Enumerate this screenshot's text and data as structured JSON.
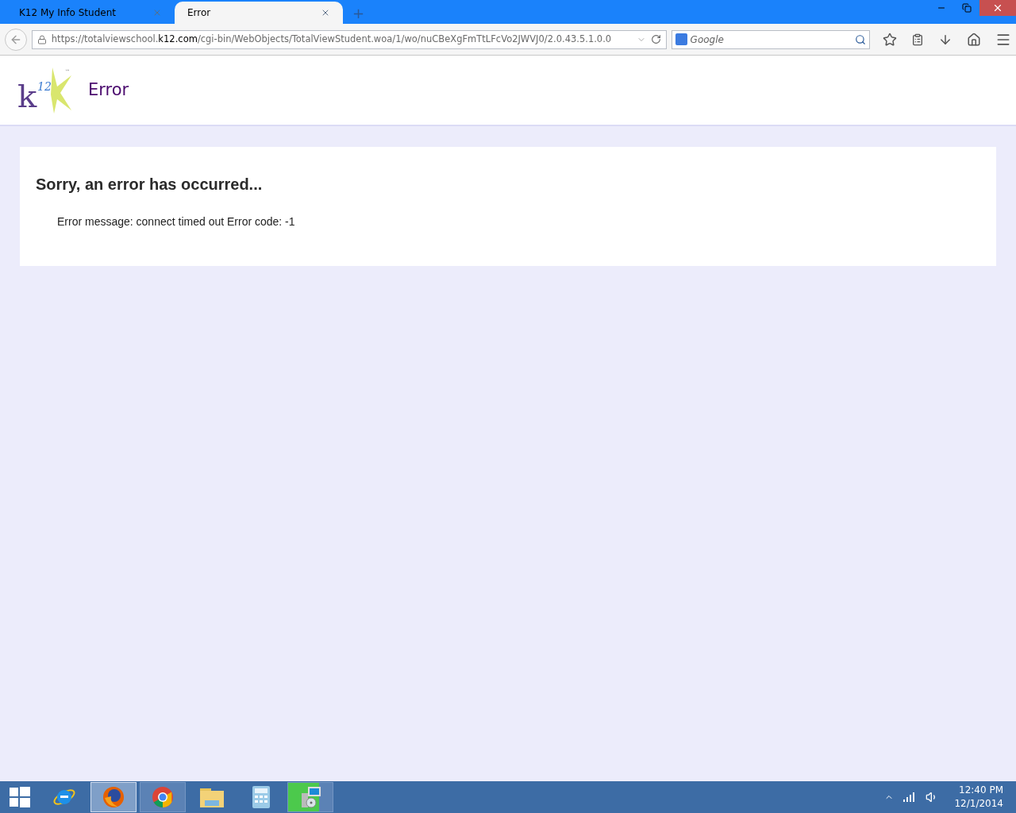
{
  "browser": {
    "tabs": [
      {
        "title": "K12 My Info Student",
        "selected": false
      },
      {
        "title": "Error",
        "selected": true
      }
    ],
    "new_tab": "+",
    "address": {
      "prefix": "https://totalviewschool.",
      "domain": "k12.com",
      "path": "/cgi-bin/WebObjects/TotalViewStudent.woa/1/wo/nuCBeXgFmTtLFcVo2JWVJ0/2.0.43.5.1.0.0"
    },
    "search": {
      "placeholder": "Google"
    }
  },
  "page": {
    "logo": {
      "letter": "k",
      "superscript": "12",
      "tm": "™"
    },
    "title": "Error",
    "heading": "Sorry, an error has occurred...",
    "message": "Error message: connect timed out Error code: -1"
  },
  "taskbar": {
    "apps": [
      {
        "kind": "ie",
        "selected": false,
        "running": false
      },
      {
        "kind": "firefox",
        "selected": true,
        "running": true
      },
      {
        "kind": "chrome",
        "selected": false,
        "running": true
      },
      {
        "kind": "explorer",
        "selected": false,
        "running": false
      },
      {
        "kind": "calculator",
        "selected": false,
        "running": false
      },
      {
        "kind": "installer",
        "selected": false,
        "running": true,
        "level": 0.7
      }
    ],
    "time": "12:40 PM",
    "date": "12/1/2014"
  }
}
